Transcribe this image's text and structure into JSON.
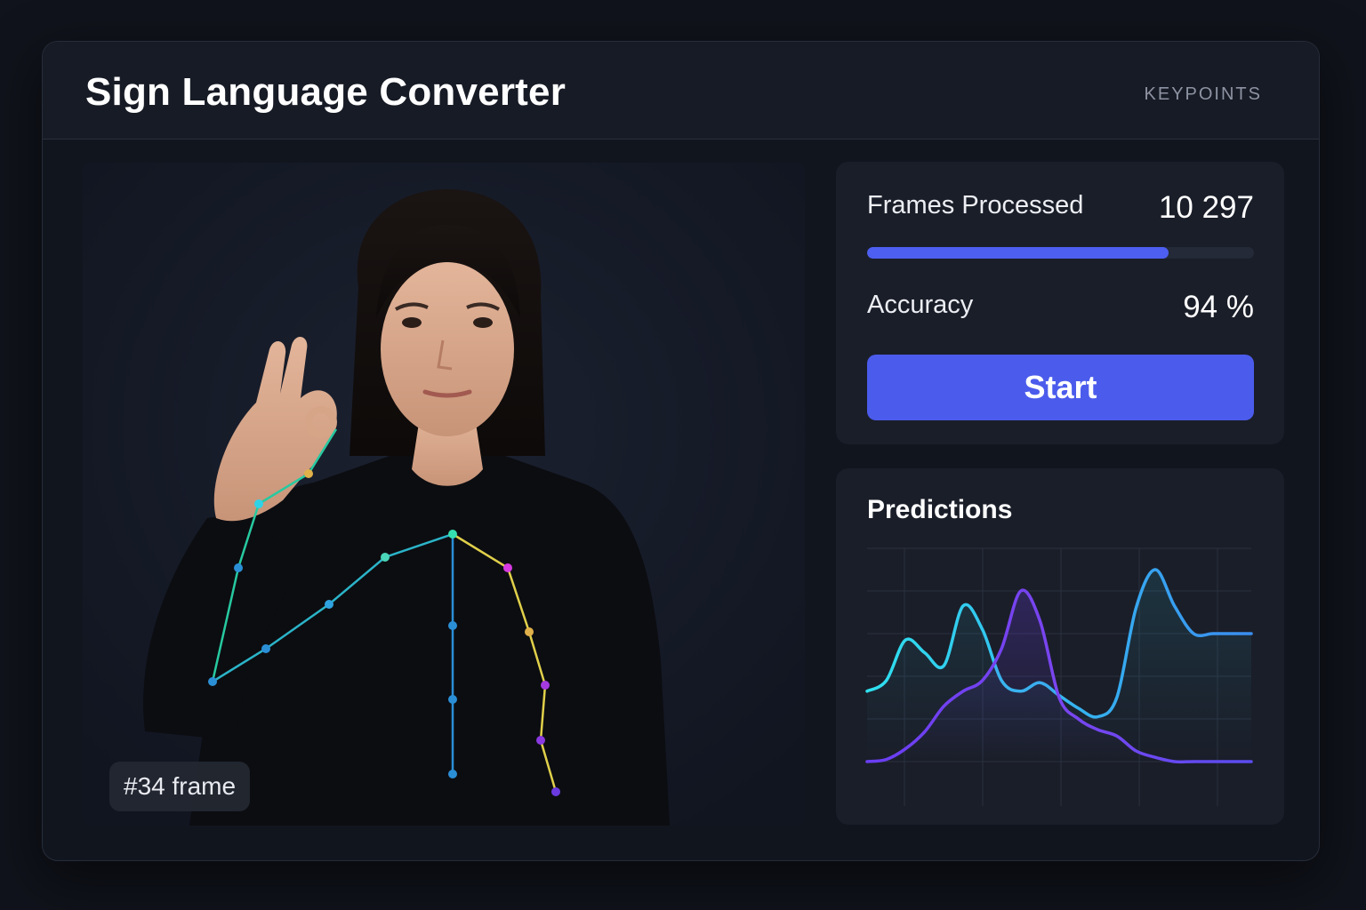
{
  "header": {
    "title": "Sign Language Converter",
    "tab_label": "KEYPOINTS"
  },
  "video": {
    "frame_label": "#34 frame"
  },
  "stats": {
    "frames_label": "Frames Processed",
    "frames_value": "10 297",
    "frames_progress": 0.78,
    "accuracy_label": "Accuracy",
    "accuracy_value": "94 %",
    "start_label": "Start"
  },
  "predictions": {
    "title": "Predictions"
  },
  "colors": {
    "accent": "#4b5cec",
    "series_cyan": "#2fd3e8",
    "series_purple": "#6f3df0"
  },
  "chart_data": {
    "type": "line",
    "title": "Predictions",
    "xlim": [
      0,
      10
    ],
    "ylim": [
      0,
      1
    ],
    "grid": true,
    "series": [
      {
        "x": [
          0,
          0.5,
          1.0,
          1.5,
          2.0,
          2.5,
          3.0,
          3.5,
          4.0,
          4.5,
          5.0,
          5.5,
          6.0,
          6.5,
          7.0,
          7.5,
          8.0,
          8.5,
          9.0,
          9.5,
          10.0
        ],
        "values": [
          0.33,
          0.38,
          0.57,
          0.51,
          0.45,
          0.73,
          0.62,
          0.38,
          0.33,
          0.37,
          0.31,
          0.25,
          0.21,
          0.3,
          0.72,
          0.9,
          0.73,
          0.6,
          0.6,
          0.6,
          0.6
        ]
      },
      {
        "x": [
          0,
          0.5,
          1.0,
          1.5,
          2.0,
          2.5,
          3.0,
          3.5,
          4.0,
          4.5,
          5.0,
          5.5,
          6.0,
          6.5,
          7.0,
          7.5,
          8.0,
          8.5,
          9.0,
          9.5,
          10.0
        ],
        "values": [
          0.0,
          0.01,
          0.06,
          0.14,
          0.26,
          0.33,
          0.38,
          0.53,
          0.8,
          0.66,
          0.3,
          0.2,
          0.15,
          0.12,
          0.05,
          0.02,
          0.0,
          0.0,
          0.0,
          0.0,
          0.0
        ]
      }
    ]
  }
}
